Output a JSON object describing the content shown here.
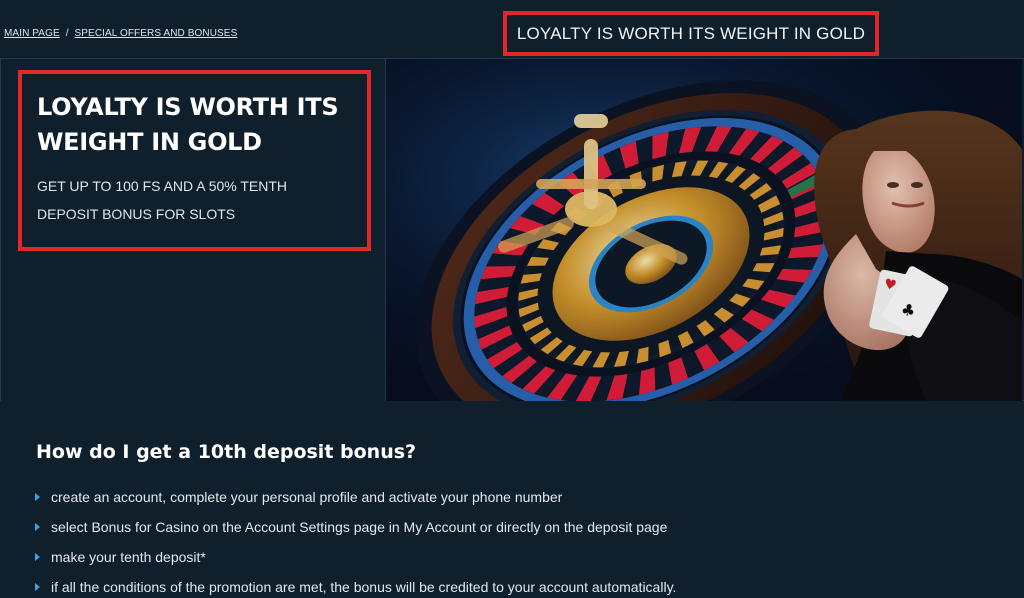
{
  "breadcrumb": {
    "home": "MAIN PAGE",
    "separator": "/",
    "current": "SPECIAL OFFERS AND BONUSES"
  },
  "header": {
    "title": "LOYALTY IS WORTH ITS WEIGHT IN GOLD"
  },
  "hero": {
    "heading_line1": "LOYALTY IS WORTH ITS",
    "heading_line2": "WEIGHT IN GOLD",
    "subheading": "GET UP TO 100 FS AND A 50% TENTH DEPOSIT BONUS FOR SLOTS",
    "image_alt": "roulette-wheel-and-croupier-with-cards"
  },
  "content": {
    "heading": "How do I get a 10th deposit bonus?",
    "steps": [
      "create an account, complete your personal profile and activate your phone number",
      "select Bonus for Casino on the Account Settings page in My Account or directly on the deposit page",
      "make your tenth deposit*",
      "if all the conditions of the promotion are met, the bonus will be credited to your account automatically."
    ]
  },
  "colors": {
    "background": "#0f1f2c",
    "highlight_border": "#e3262a",
    "bullet": "#3ea3e6",
    "text": "#e9eef2"
  }
}
